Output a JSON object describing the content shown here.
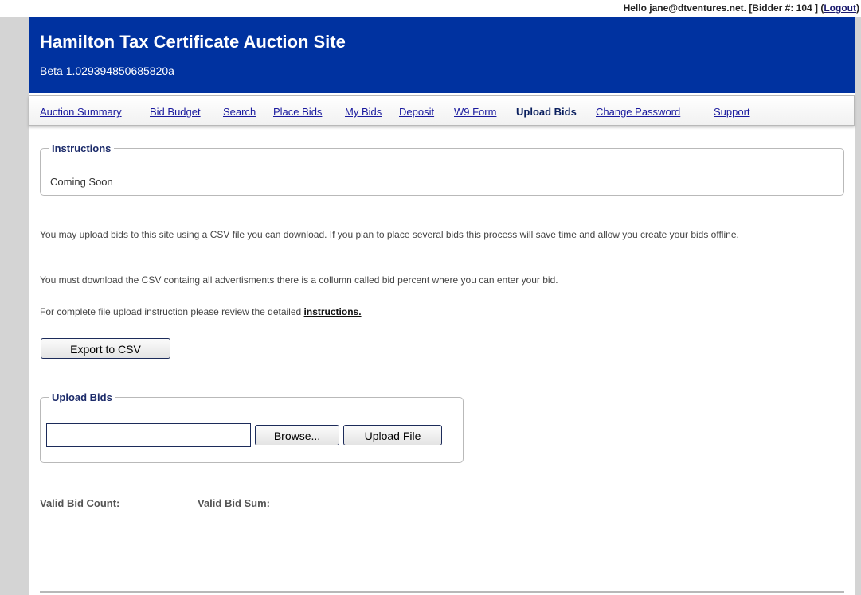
{
  "topbar": {
    "greeting_prefix": "Hello jane@dtventures.net. [Bidder #: 104 ] (",
    "logout_label": "Logout",
    "greeting_suffix": ")"
  },
  "header": {
    "title": "Hamilton Tax Certificate Auction Site",
    "version": "Beta 1.029394850685820a",
    "background_color": "#0032a0"
  },
  "nav": {
    "items": [
      {
        "label": "Auction Summary",
        "active": false
      },
      {
        "label": "Bid Budget",
        "active": false
      },
      {
        "label": "Search",
        "active": false
      },
      {
        "label": "Place Bids",
        "active": false
      },
      {
        "label": "My Bids",
        "active": false
      },
      {
        "label": "Deposit",
        "active": false
      },
      {
        "label": "W9 Form",
        "active": false
      },
      {
        "label": "Upload Bids",
        "active": true
      },
      {
        "label": "Change Password",
        "active": false
      },
      {
        "label": "Support",
        "active": false
      }
    ]
  },
  "instructions": {
    "legend": "Instructions",
    "text": "Coming Soon"
  },
  "body_text": {
    "para1": "You may upload bids to this site using a CSV file you can download. If you plan to place several bids this process will save time and allow you create your bids offline.",
    "para2": "You must download the CSV containg all advertisments there is a collumn called bid percent where you can enter your bid.",
    "para3_prefix": "For complete file upload instruction please review the detailed ",
    "para3_link": "instructions."
  },
  "export_button_label": "Export to CSV",
  "upload": {
    "legend": "Upload Bids",
    "file_value": "",
    "browse_label": "Browse...",
    "upload_label": "Upload File"
  },
  "stats": {
    "count_label": "Valid Bid Count:",
    "sum_label": "Valid Bid Sum:"
  }
}
